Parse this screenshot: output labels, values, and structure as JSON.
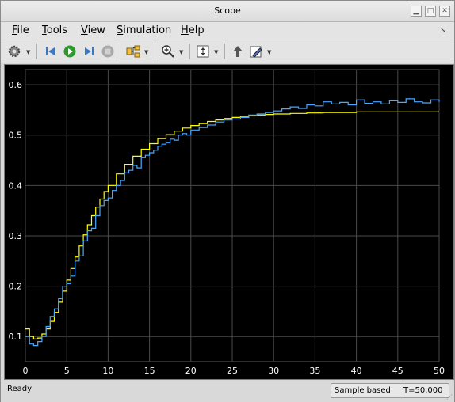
{
  "window": {
    "title": "Scope"
  },
  "menu": {
    "items": [
      {
        "pre": "",
        "u": "F",
        "post": "ile"
      },
      {
        "pre": "",
        "u": "T",
        "post": "ools"
      },
      {
        "pre": "",
        "u": "V",
        "post": "iew"
      },
      {
        "pre": "",
        "u": "S",
        "post": "imulation"
      },
      {
        "pre": "",
        "u": "H",
        "post": "elp"
      }
    ]
  },
  "toolbar": {
    "icons": [
      "settings-icon",
      "step-back-icon",
      "run-icon",
      "step-forward-icon",
      "stop-icon",
      "signal-selector-icon",
      "zoom-in-icon",
      "autoscale-icon",
      "highlight-block-icon",
      "edit-icon"
    ]
  },
  "status": {
    "ready": "Ready",
    "mode": "Sample based",
    "time": "T=50.000"
  },
  "colors": {
    "background": "#000000",
    "grid": "#4a4a4a",
    "axis_text": "#ffffff",
    "yellow": "#ffff00",
    "blue": "#4aa8ff"
  },
  "chart_data": {
    "type": "line",
    "title": "",
    "xlabel": "",
    "ylabel": "",
    "xlim": [
      0,
      50
    ],
    "ylim": [
      0.05,
      0.63
    ],
    "xticks": [
      0,
      5,
      10,
      15,
      20,
      25,
      30,
      35,
      40,
      45,
      50
    ],
    "yticks": [
      0.1,
      0.2,
      0.3,
      0.4,
      0.5,
      0.6
    ],
    "grid": true,
    "series": [
      {
        "color": "#ffff00",
        "step": true,
        "x": [
          0,
          0.5,
          1,
          1.5,
          2,
          2.5,
          3,
          3.5,
          4,
          4.5,
          5,
          5.5,
          6,
          6.5,
          7,
          7.5,
          8,
          8.5,
          9,
          9.5,
          10,
          11,
          12,
          13,
          14,
          15,
          16,
          17,
          18,
          19,
          20,
          21,
          22,
          23,
          24,
          25,
          26,
          27,
          28,
          29,
          30,
          32,
          34,
          36,
          38,
          40,
          42,
          44,
          46,
          48,
          50
        ],
        "y": [
          0.115,
          0.1,
          0.095,
          0.097,
          0.105,
          0.115,
          0.13,
          0.148,
          0.168,
          0.19,
          0.212,
          0.235,
          0.258,
          0.28,
          0.302,
          0.322,
          0.34,
          0.357,
          0.373,
          0.388,
          0.4,
          0.423,
          0.442,
          0.458,
          0.472,
          0.483,
          0.493,
          0.501,
          0.508,
          0.514,
          0.519,
          0.523,
          0.527,
          0.53,
          0.533,
          0.535,
          0.537,
          0.539,
          0.54,
          0.541,
          0.542,
          0.543,
          0.544,
          0.545,
          0.545,
          0.546,
          0.546,
          0.546,
          0.546,
          0.546,
          0.546
        ]
      },
      {
        "color": "#4aa8ff",
        "step": true,
        "x": [
          0,
          0.5,
          1,
          1.5,
          2,
          2.5,
          3,
          3.5,
          4,
          4.5,
          5,
          5.5,
          6,
          6.5,
          7,
          7.5,
          8,
          8.5,
          9,
          9.5,
          10,
          10.5,
          11,
          11.5,
          12,
          12.5,
          13,
          13.5,
          14,
          14.5,
          15,
          15.5,
          16,
          16.5,
          17,
          17.5,
          18,
          18.5,
          19,
          19.5,
          20,
          21,
          22,
          23,
          24,
          25,
          26,
          27,
          28,
          29,
          30,
          31,
          32,
          33,
          34,
          35,
          36,
          37,
          38,
          39,
          40,
          41,
          42,
          43,
          44,
          45,
          46,
          47,
          48,
          49,
          50
        ],
        "y": [
          0.1,
          0.085,
          0.082,
          0.09,
          0.1,
          0.12,
          0.14,
          0.155,
          0.175,
          0.2,
          0.205,
          0.22,
          0.25,
          0.26,
          0.29,
          0.31,
          0.315,
          0.34,
          0.36,
          0.37,
          0.375,
          0.39,
          0.4,
          0.41,
          0.425,
          0.43,
          0.44,
          0.435,
          0.455,
          0.46,
          0.465,
          0.47,
          0.478,
          0.482,
          0.485,
          0.492,
          0.49,
          0.5,
          0.503,
          0.5,
          0.51,
          0.515,
          0.52,
          0.526,
          0.53,
          0.532,
          0.535,
          0.54,
          0.542,
          0.545,
          0.548,
          0.552,
          0.556,
          0.553,
          0.56,
          0.558,
          0.566,
          0.562,
          0.565,
          0.56,
          0.57,
          0.563,
          0.566,
          0.562,
          0.568,
          0.565,
          0.572,
          0.566,
          0.564,
          0.57,
          0.566
        ]
      }
    ]
  }
}
